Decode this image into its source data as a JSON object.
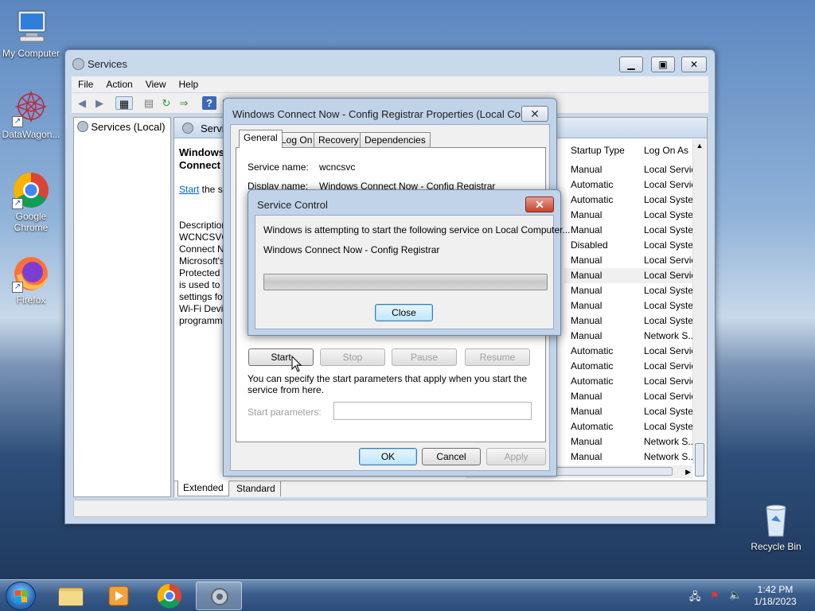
{
  "desktop": {
    "icons": [
      {
        "label": "My Computer"
      },
      {
        "label": "DataWagon..."
      },
      {
        "label": "Google Chrome"
      },
      {
        "label": "Firefox"
      },
      {
        "label": "Recycle Bin"
      }
    ]
  },
  "services_window": {
    "title": "Services",
    "menu": [
      "File",
      "Action",
      "View",
      "Help"
    ],
    "tree_item": "Services (Local)",
    "header_label": "Servi",
    "service_title": "Windows Connect Now - Config Registrar",
    "start_link": "Start",
    "start_link_suffix": " the se",
    "description_lines": [
      "Description",
      "WCNCSVC",
      "Connect N",
      "Microsoft's",
      "Protected",
      "is used to",
      "settings fo",
      "Wi-Fi Devi",
      "programm"
    ],
    "columns": {
      "startup_type": "Startup Type",
      "log_on_as": "Log On As"
    },
    "rows": [
      {
        "startup": "Manual",
        "logon": "Local Servic"
      },
      {
        "startup": "Automatic",
        "logon": "Local Servic"
      },
      {
        "startup": "Automatic",
        "logon": "Local Syste."
      },
      {
        "startup": "Manual",
        "logon": "Local Syste."
      },
      {
        "startup": "Manual",
        "logon": "Local Syste."
      },
      {
        "startup": "Disabled",
        "logon": "Local Syste."
      },
      {
        "startup": "Manual",
        "logon": "Local Servic"
      },
      {
        "startup": "Manual",
        "logon": "Local Servic"
      },
      {
        "startup": "Manual",
        "logon": "Local Syste."
      },
      {
        "startup": "Manual",
        "logon": "Local Syste."
      },
      {
        "startup": "Manual",
        "logon": "Local Syste."
      },
      {
        "startup": "Manual",
        "logon": "Network S..."
      },
      {
        "startup": "Automatic",
        "logon": "Local Servic"
      },
      {
        "startup": "Automatic",
        "logon": "Local Servic"
      },
      {
        "startup": "Automatic",
        "logon": "Local Servic"
      },
      {
        "startup": "Manual",
        "logon": "Local Servic"
      },
      {
        "startup": "Manual",
        "logon": "Local Syste."
      },
      {
        "startup": "Automatic",
        "logon": "Local Syste."
      },
      {
        "startup": "Manual",
        "logon": "Network S..."
      },
      {
        "startup": "Manual",
        "logon": "Network S..."
      }
    ],
    "bottom_tabs": [
      "Extended",
      "Standard"
    ]
  },
  "properties_dialog": {
    "title": "Windows Connect Now - Config Registrar Properties (Local Comp...",
    "tabs": [
      "General",
      "Log On",
      "Recovery",
      "Dependencies"
    ],
    "service_name_label": "Service name:",
    "service_name_value": "wcncsvc",
    "display_name_label": "Display name:",
    "display_name_value": "Windows Connect Now - Config Registrar",
    "buttons": {
      "start": "Start",
      "stop": "Stop",
      "pause": "Pause",
      "resume": "Resume"
    },
    "hint_text": "You can specify the start parameters that apply when you start the service from here.",
    "start_params_label": "Start parameters:",
    "start_params_value": "",
    "ok": "OK",
    "cancel": "Cancel",
    "apply": "Apply"
  },
  "service_control": {
    "title": "Service Control",
    "message": "Windows is attempting to start the following service on Local Computer...",
    "service": "Windows Connect Now - Config Registrar",
    "progress": 0,
    "close": "Close"
  },
  "taskbar": {
    "time": "1:42 PM",
    "date": "1/18/2023"
  }
}
